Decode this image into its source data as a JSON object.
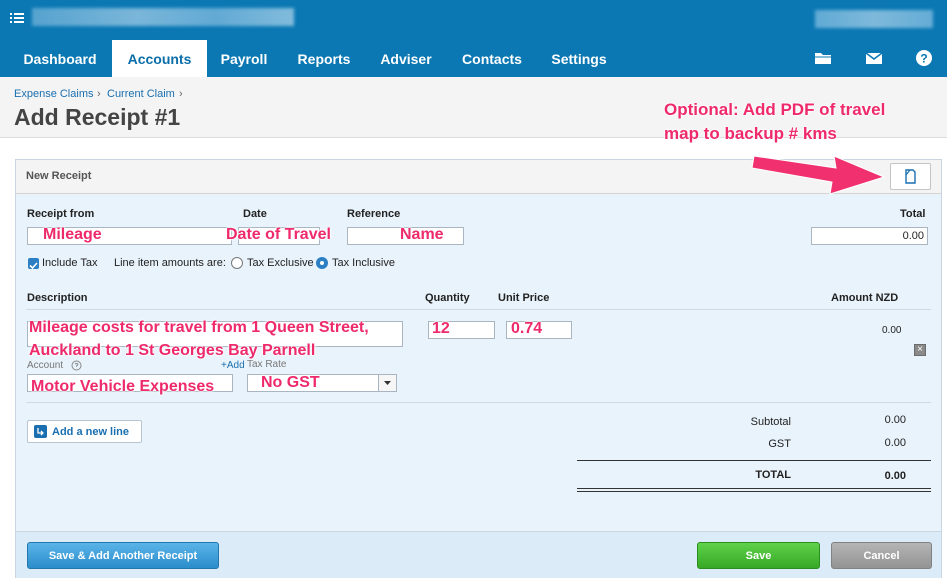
{
  "nav": {
    "tabs": [
      {
        "label": "Dashboard"
      },
      {
        "label": "Accounts"
      },
      {
        "label": "Payroll"
      },
      {
        "label": "Reports"
      },
      {
        "label": "Adviser"
      },
      {
        "label": "Contacts"
      },
      {
        "label": "Settings"
      }
    ],
    "active_tab": "Accounts",
    "icons": [
      "folder-icon",
      "mail-icon",
      "help-icon"
    ],
    "help_glyph": "?"
  },
  "breadcrumb": {
    "items": [
      "Expense Claims",
      "Current Claim"
    ],
    "separator": "›"
  },
  "page": {
    "title": "Add Receipt #1"
  },
  "annotations": {
    "pdf_line1": "Optional: Add PDF of travel",
    "pdf_line2": "map to backup # kms",
    "receipt_from": "Mileage",
    "date": "Date of Travel",
    "reference": "Name",
    "description_line1": "Mileage costs for travel from 1 Queen Street,",
    "description_line2": "Auckland to 1 St Georges Bay Parnell",
    "account": "Motor Vehicle Expenses",
    "tax_rate": "No GST",
    "quantity": "12",
    "unit_price": "0.74"
  },
  "receipt": {
    "panel_title": "New Receipt",
    "labels": {
      "receipt_from": "Receipt from",
      "date": "Date",
      "reference": "Reference",
      "total": "Total",
      "include_tax": "Include Tax",
      "amounts_are": "Line item amounts are:",
      "tax_exclusive": "Tax Exclusive",
      "tax_inclusive": "Tax Inclusive"
    },
    "total_value": "0.00",
    "include_tax_checked": true,
    "tax_mode": "Tax Inclusive"
  },
  "line_items": {
    "headers": {
      "description": "Description",
      "quantity": "Quantity",
      "unit_price": "Unit Price",
      "amount": "Amount NZD"
    },
    "account_label": "Account",
    "add_account": "+Add",
    "tax_rate_label": "Tax Rate",
    "row_amount": "0.00"
  },
  "add_line_button": "Add a new line",
  "totals": {
    "subtotal_label": "Subtotal",
    "subtotal_value": "0.00",
    "gst_label": "GST",
    "gst_value": "0.00",
    "total_label": "TOTAL",
    "total_value": "0.00"
  },
  "footer": {
    "save_add_another": "Save & Add Another Receipt",
    "save": "Save",
    "cancel": "Cancel"
  },
  "colors": {
    "brand_blue": "#0b78b3",
    "annotation_pink": "#ee2a6b",
    "save_green": "#36a825"
  }
}
